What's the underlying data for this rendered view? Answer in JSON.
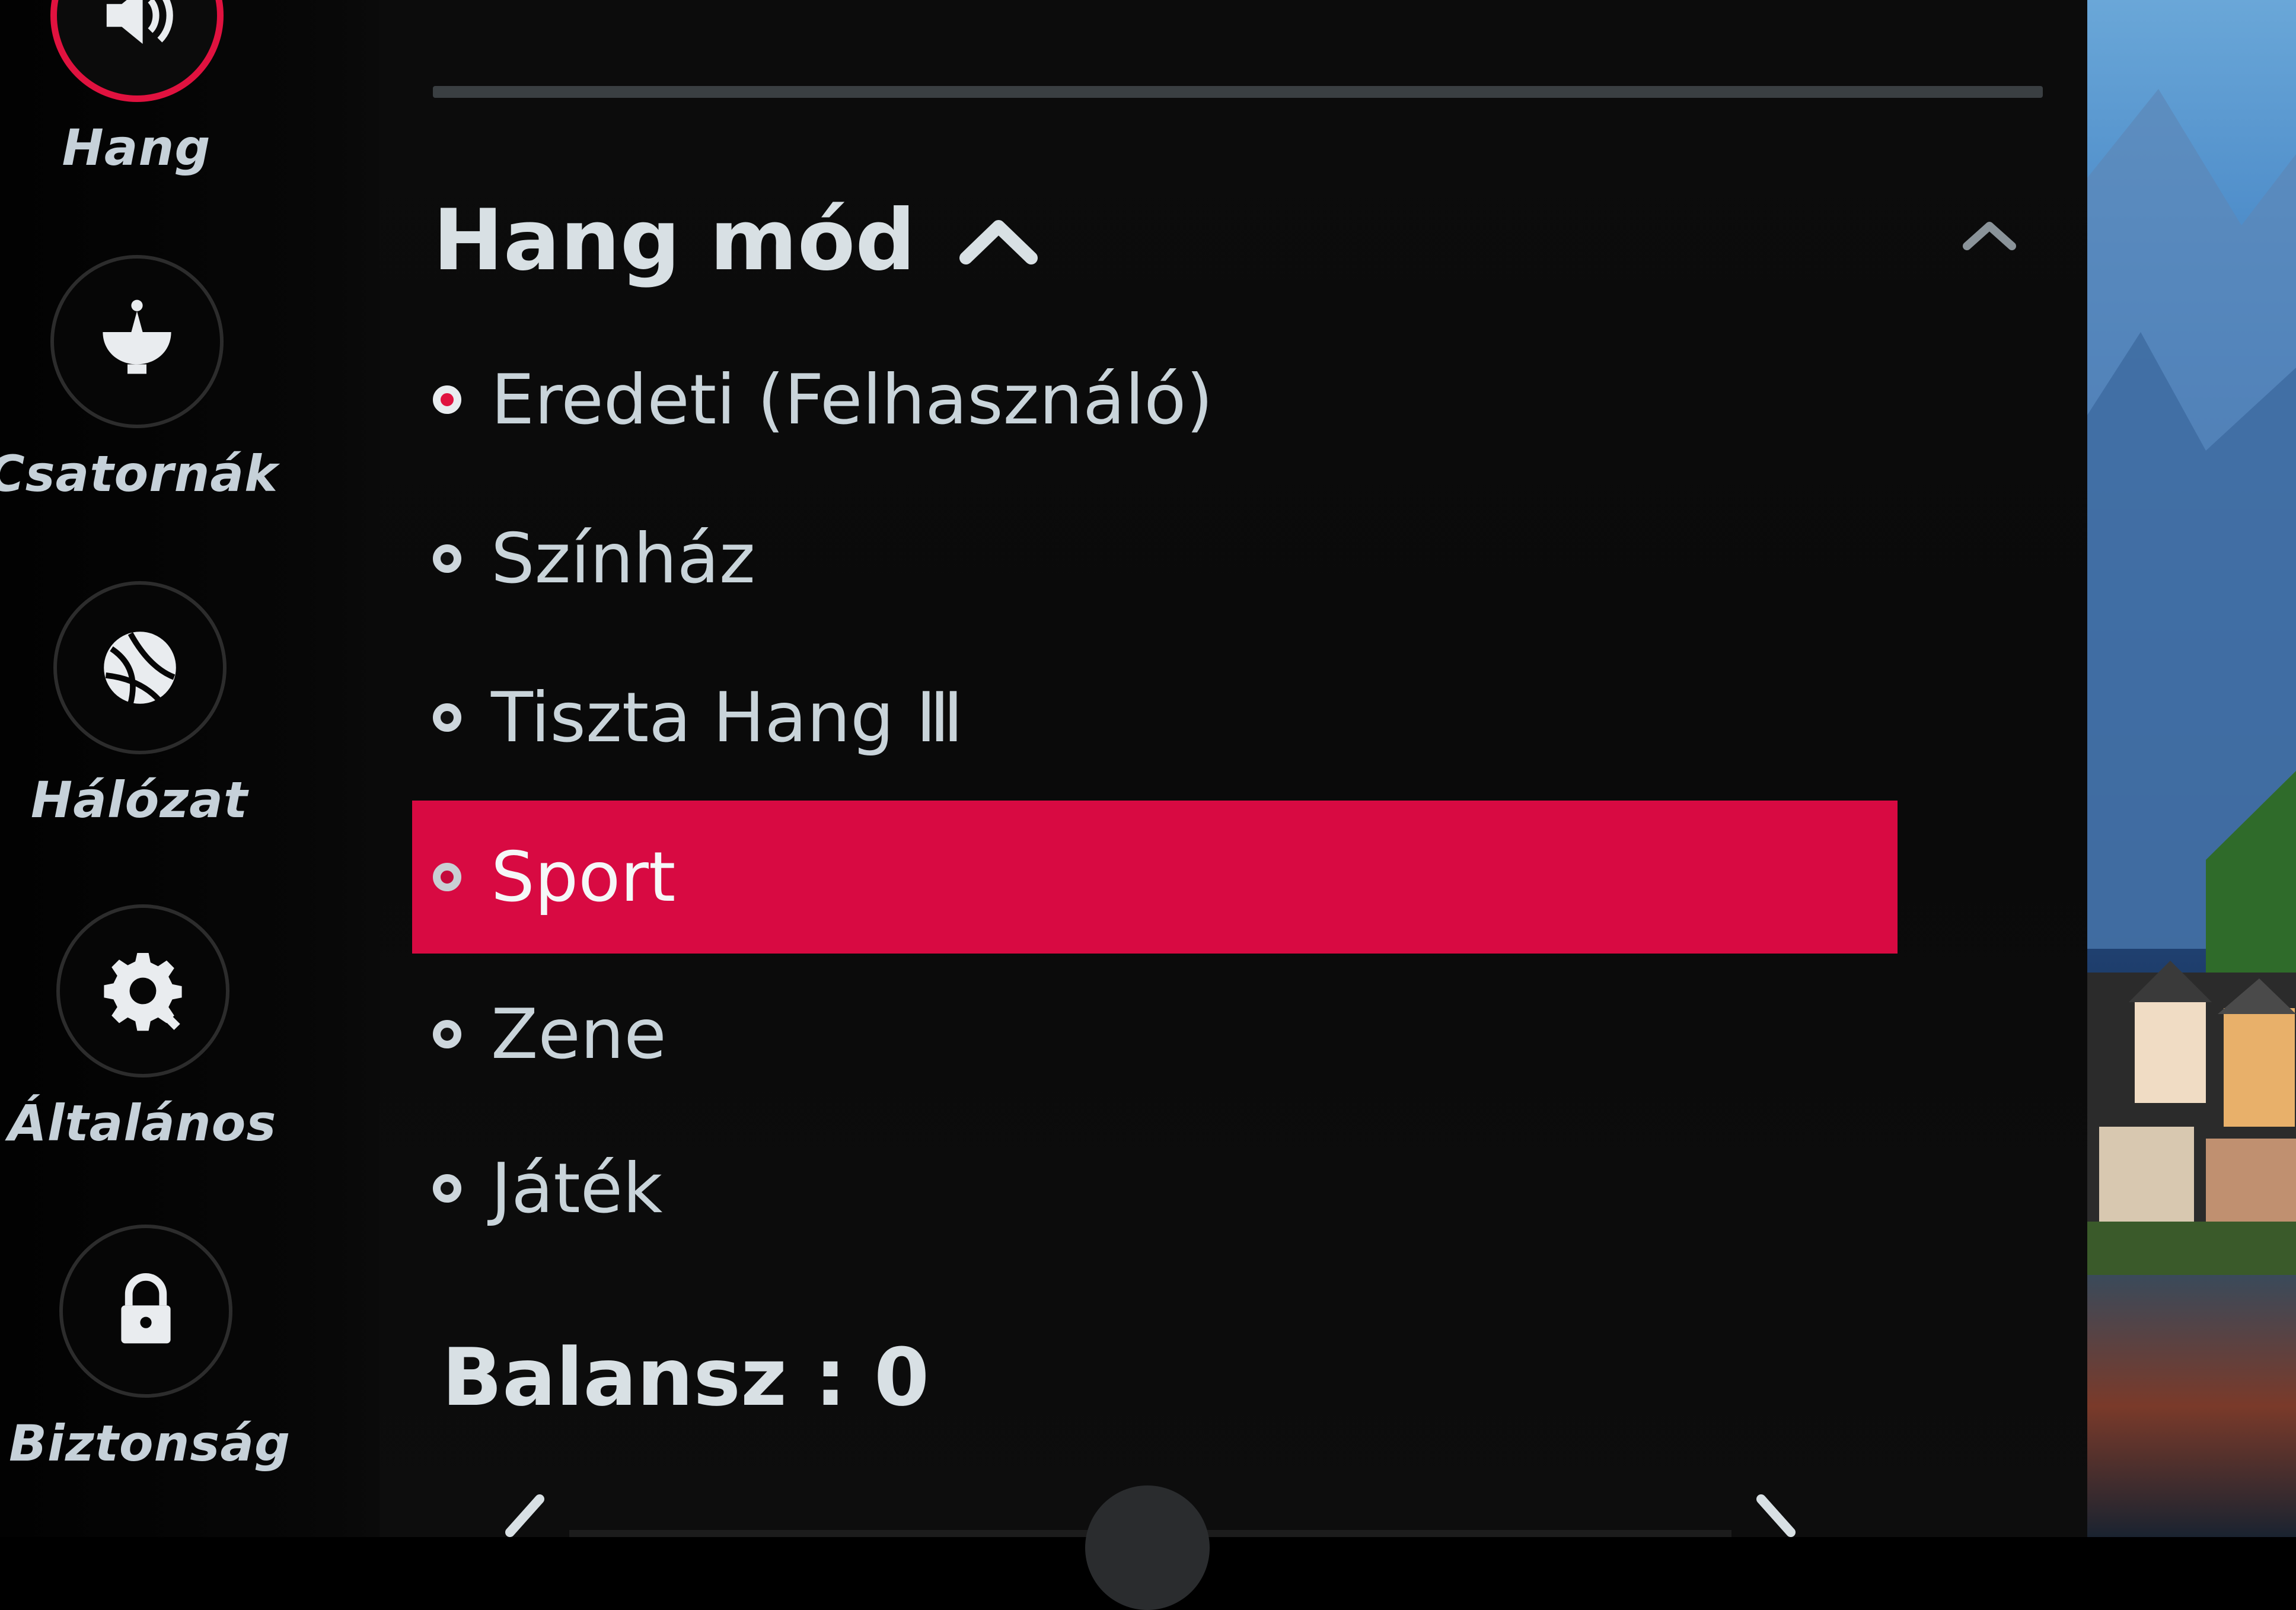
{
  "sidebar": {
    "items": [
      {
        "label": "Hang",
        "icon": "speaker-icon",
        "active": true
      },
      {
        "label": "Csatornák",
        "icon": "satellite-dish-icon",
        "active": false
      },
      {
        "label": "Hálózat",
        "icon": "globe-network-icon",
        "active": false
      },
      {
        "label": "Általános",
        "icon": "gear-wrench-icon",
        "active": false
      },
      {
        "label": "Biztonság",
        "icon": "lock-icon",
        "active": false
      }
    ]
  },
  "menu": {
    "section_title": "Hang mód",
    "options": [
      {
        "label": "Eredeti (Felhasználó)",
        "checked": true,
        "highlighted": false
      },
      {
        "label": "Színház",
        "checked": false,
        "highlighted": false
      },
      {
        "label": "Tiszta Hang  Ⅲ",
        "checked": false,
        "highlighted": false
      },
      {
        "label": "Sport",
        "checked": false,
        "highlighted": true
      },
      {
        "label": "Zene",
        "checked": false,
        "highlighted": false
      },
      {
        "label": "Játék",
        "checked": false,
        "highlighted": false
      }
    ],
    "balance_label": "Balansz : 0"
  },
  "colors": {
    "accent": "#d80a42",
    "text": "#c9d4da",
    "background": "#0a0a0a"
  }
}
